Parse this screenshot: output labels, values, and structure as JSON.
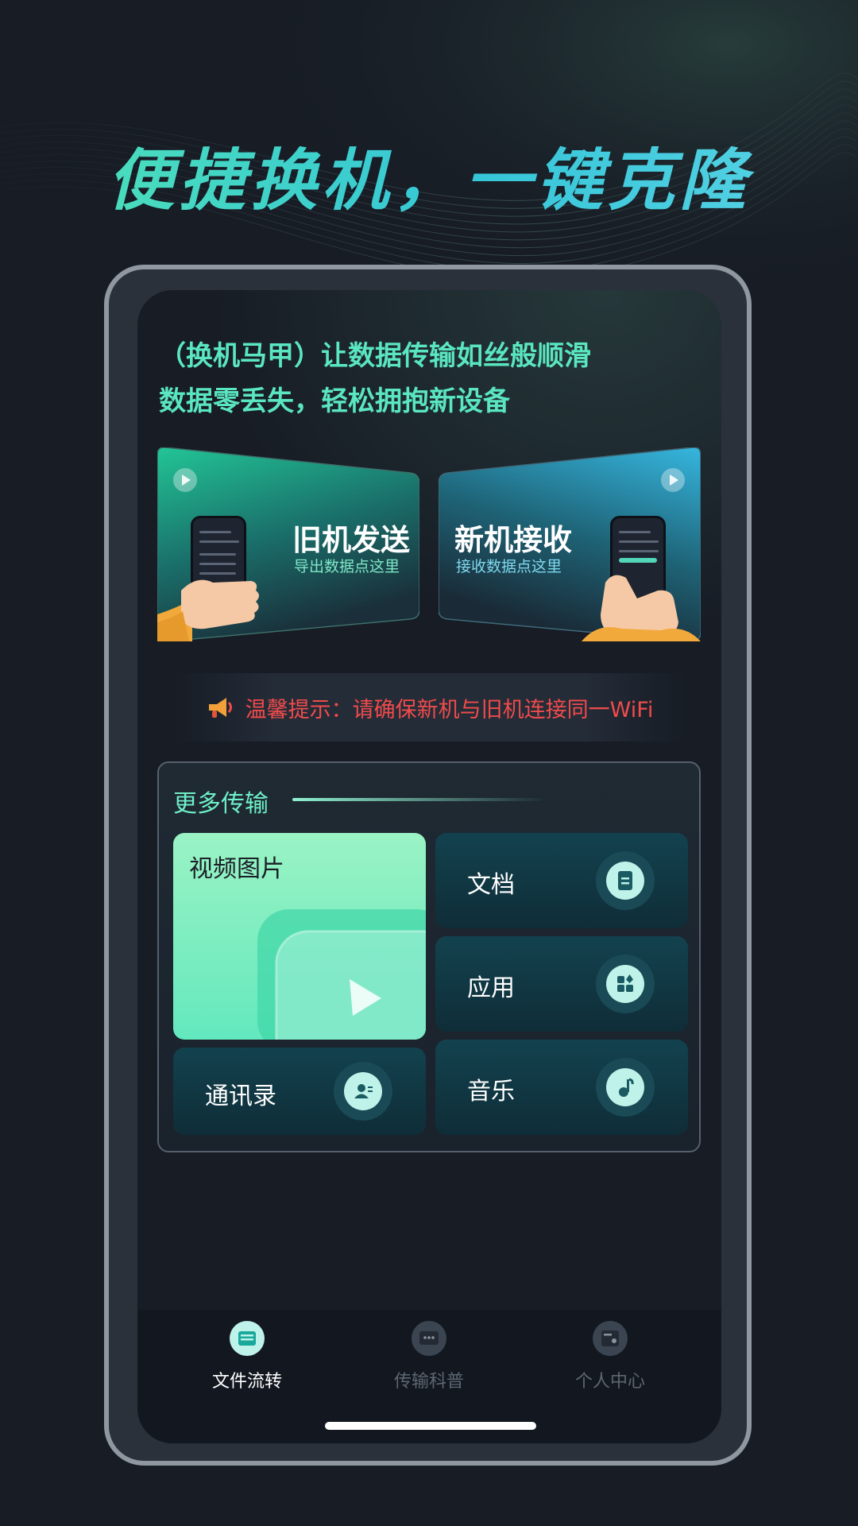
{
  "hero_title": "便捷换机，一键克隆",
  "slogan": {
    "line1": "（换机马甲）让数据传输如丝般顺滑",
    "line2": "数据零丢失，轻松拥抱新设备"
  },
  "cards": {
    "old": {
      "title": "旧机发送",
      "subtitle": "导出数据点这里",
      "icon": "play-icon"
    },
    "new": {
      "title": "新机接收",
      "subtitle": "接收数据点这里",
      "icon": "play-icon"
    }
  },
  "tip": {
    "text": "温馨提示：请确保新机与旧机连接同一WiFi",
    "icon": "megaphone-icon"
  },
  "more": {
    "heading": "更多传输",
    "items": {
      "media": {
        "label": "视频图片",
        "icon": "play-icon"
      },
      "docs": {
        "label": "文档",
        "icon": "document-icon"
      },
      "apps": {
        "label": "应用",
        "icon": "apps-icon"
      },
      "contacts": {
        "label": "通讯录",
        "icon": "contact-icon"
      },
      "music": {
        "label": "音乐",
        "icon": "music-icon"
      }
    }
  },
  "tabs": [
    {
      "label": "文件流转",
      "active": true,
      "icon": "files-icon"
    },
    {
      "label": "传输科普",
      "active": false,
      "icon": "chat-icon"
    },
    {
      "label": "个人中心",
      "active": false,
      "icon": "profile-icon"
    }
  ],
  "colors": {
    "background": "#171c25",
    "accent_green": "#5ae6bf",
    "tip_red": "#f04b4b",
    "card_old": "#1fb892",
    "card_new": "#2a9fb8"
  }
}
